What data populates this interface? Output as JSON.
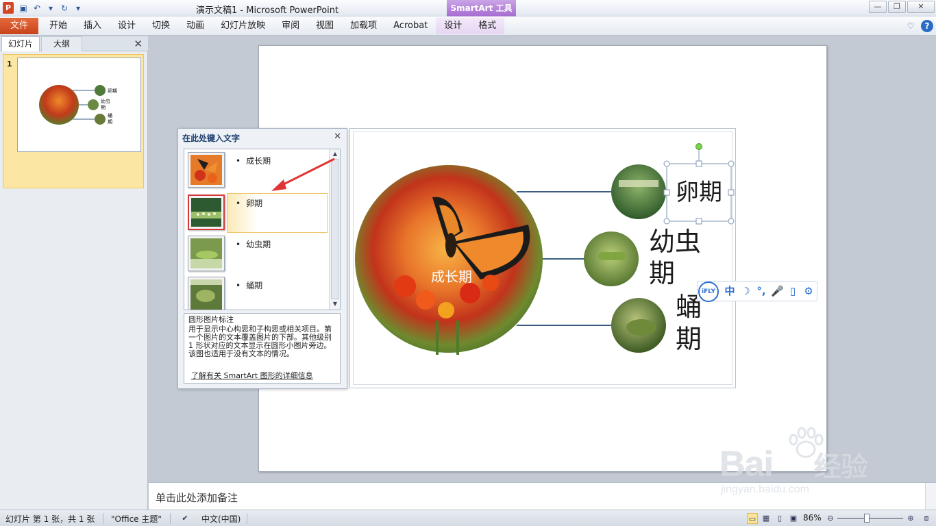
{
  "window": {
    "title": "演示文稿1 - Microsoft PowerPoint",
    "app_icon": "P",
    "contextual_tab_group": "SmartArt 工具"
  },
  "ribbon": {
    "file_tab": "文件",
    "tabs": [
      "开始",
      "插入",
      "设计",
      "切换",
      "动画",
      "幻灯片放映",
      "审阅",
      "视图",
      "加载项",
      "Acrobat"
    ],
    "smartart_tabs": [
      "设计",
      "格式"
    ]
  },
  "left_panel": {
    "tab_slides": "幻灯片",
    "tab_outline": "大纲",
    "close": "✕",
    "slide_number": "1",
    "thumb_labels": [
      "卵期",
      "幼虫",
      "期",
      "蛹",
      "期"
    ]
  },
  "text_pane": {
    "title": "在此处键入文字",
    "close": "✕",
    "items": [
      "成长期",
      "卵期",
      "幼虫期",
      "蛹期"
    ],
    "desc_title": "圆形图片标注",
    "desc_body": "用于显示中心构思和子构思或相关项目。第一个图片的文本覆盖图片的下部。其他级别 1 形状对应的文本显示在圆形小图片旁边。该图也适用于没有文本的情况。",
    "desc_link": "了解有关 SmartArt 图形的详细信息"
  },
  "smartart": {
    "center_label": "成长期",
    "labels": [
      {
        "line1": "卵期",
        "line2": ""
      },
      {
        "line1": "幼虫",
        "line2": "期"
      },
      {
        "line1": "蛹",
        "line2": "期"
      }
    ]
  },
  "ifly": {
    "logo": "iFLY",
    "icons": [
      "中",
      "☽",
      "°,",
      "🎤",
      "▯",
      "⚙"
    ]
  },
  "notes": {
    "placeholder": "单击此处添加备注"
  },
  "status": {
    "slide_info": "幻灯片 第 1 张，共 1 张",
    "theme": "\"Office 主题\"",
    "language": "中文(中国)",
    "zoom": "86%"
  },
  "watermark": {
    "brand": "Bai",
    "brand2": "经验",
    "url": "jingyan.baidu.com"
  },
  "colors": {
    "file_tab": "#c8431b",
    "smartart_group": "#a66bd1",
    "selection_red": "#d43a3a",
    "connector": "#3a5f80"
  }
}
